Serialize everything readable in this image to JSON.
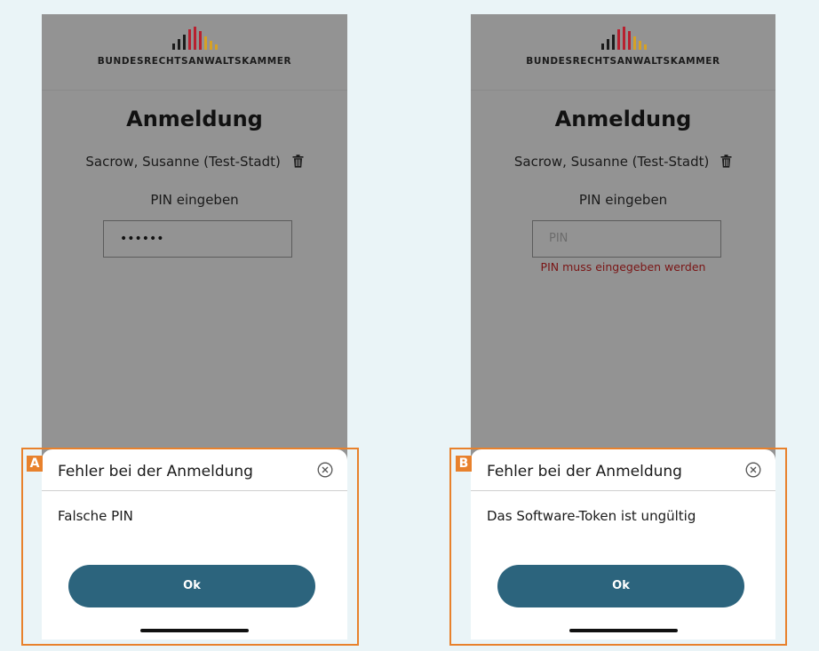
{
  "colors": {
    "background": "#eaf4f7",
    "screen_overlay": "#939393",
    "sheet": "#ffffff",
    "ok_button": "#2c647d",
    "callout_orange": "#e8812c",
    "error_text": "#7a1515",
    "logo_red": "#b8202f",
    "logo_gold": "#d6a125",
    "logo_black": "#1b1b1b"
  },
  "screens": [
    {
      "id": "A",
      "badge": "A",
      "brand": "BUNDESRECHTSANWALTSKAMMER",
      "login_title": "Anmeldung",
      "user_name": "Sacrow, Susanne (Test-Stadt)",
      "pin_label": "PIN eingeben",
      "pin_value": "••••••",
      "pin_placeholder": "",
      "pin_error": "",
      "dialog": {
        "title": "Fehler bei der Anmeldung",
        "message": "Falsche PIN",
        "ok_label": "Ok"
      }
    },
    {
      "id": "B",
      "badge": "B",
      "brand": "BUNDESRECHTSANWALTSKAMMER",
      "login_title": "Anmeldung",
      "user_name": "Sacrow, Susanne (Test-Stadt)",
      "pin_label": "PIN eingeben",
      "pin_value": "",
      "pin_placeholder": "PIN",
      "pin_error": "PIN muss eingegeben werden",
      "dialog": {
        "title": "Fehler bei der Anmeldung",
        "message": "Das Software-Token ist ungültig",
        "ok_label": "Ok"
      }
    }
  ]
}
